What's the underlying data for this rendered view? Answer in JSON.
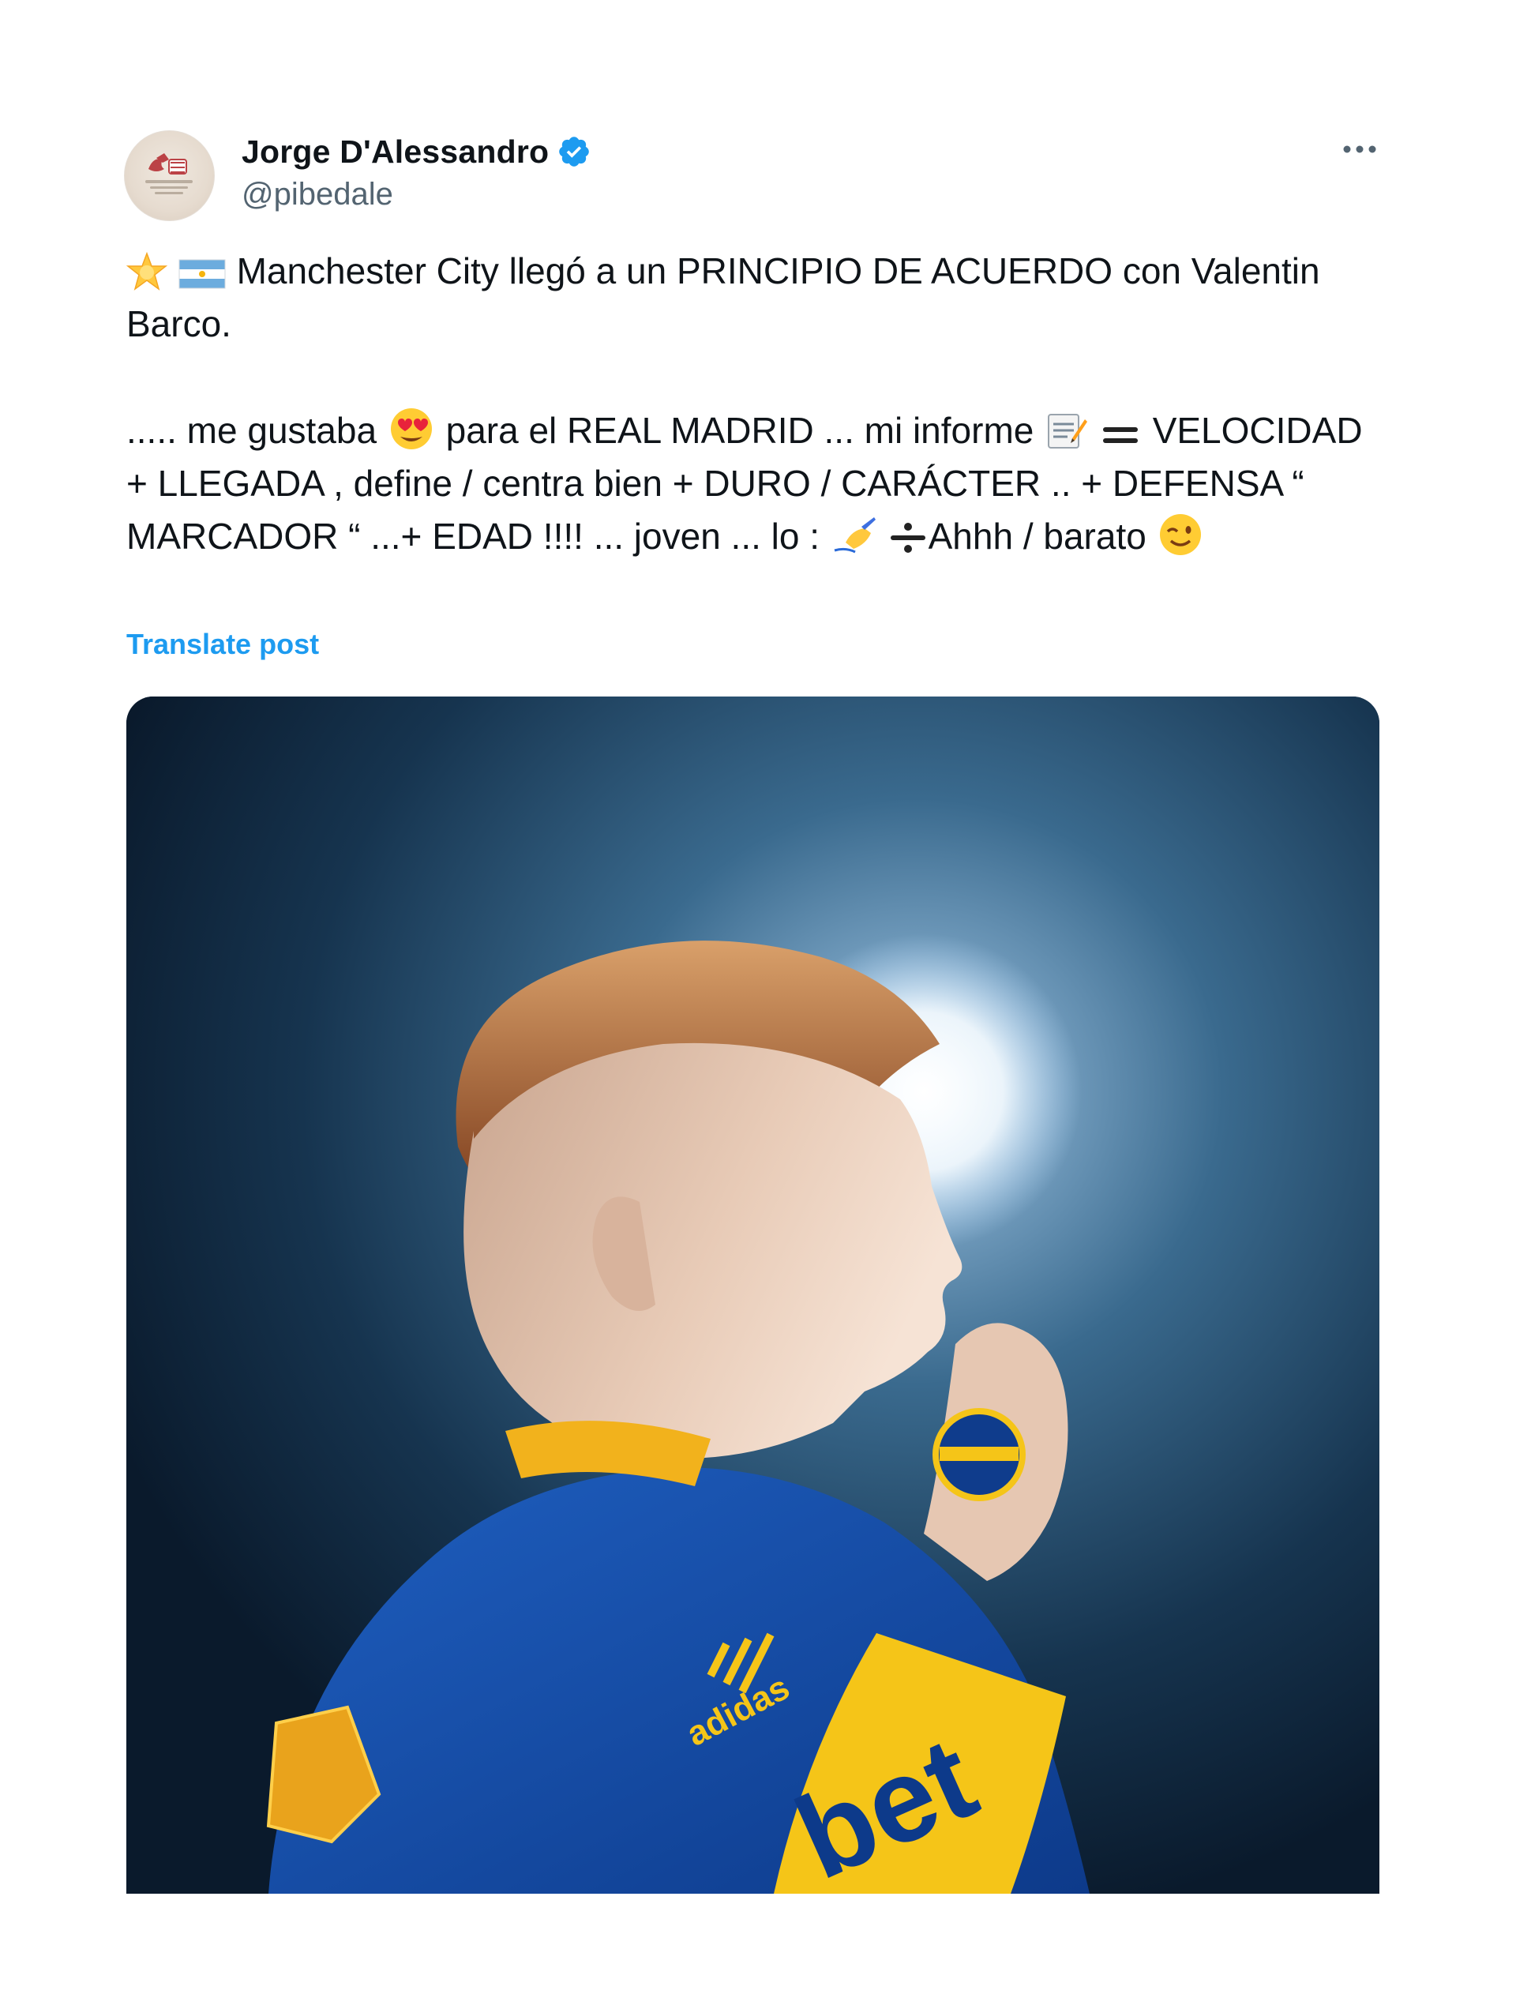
{
  "post": {
    "author": {
      "display_name": "Jorge D'Alessandro",
      "handle": "@pibedale",
      "verified": true,
      "verified_badge_icon": "verified-badge-icon",
      "verified_color": "#1d9bf0"
    },
    "more_icon": "more-horizontal-icon",
    "text": {
      "line1": "Manchester City llegó a un PRINCIPIO DE ACUERDO con Valentin Barco.",
      "p2_part1": "..... me gustaba",
      "p2_part2": "para el REAL MADRID ... mi informe",
      "p2_part3": "VELOCIDAD + LLEGADA , define / centra bien + DURO / CARÁCTER  .. + DEFENSA “ MARCADOR “ ...+  EDAD !!!! ... joven ... lo :",
      "p2_part4": "Ahhh / barato"
    },
    "emojis": [
      "star-emoji",
      "argentina-flag-emoji",
      "heart-eyes-emoji",
      "memo-emoji",
      "equals-emoji",
      "writing-hand-emoji",
      "divide-emoji",
      "wink-emoji"
    ],
    "translate_label": "Translate post",
    "link_color": "#1d9bf0",
    "media": {
      "description_icon": "player-photo-image",
      "shirt_text": "bet",
      "brand_text": "adidas"
    }
  }
}
